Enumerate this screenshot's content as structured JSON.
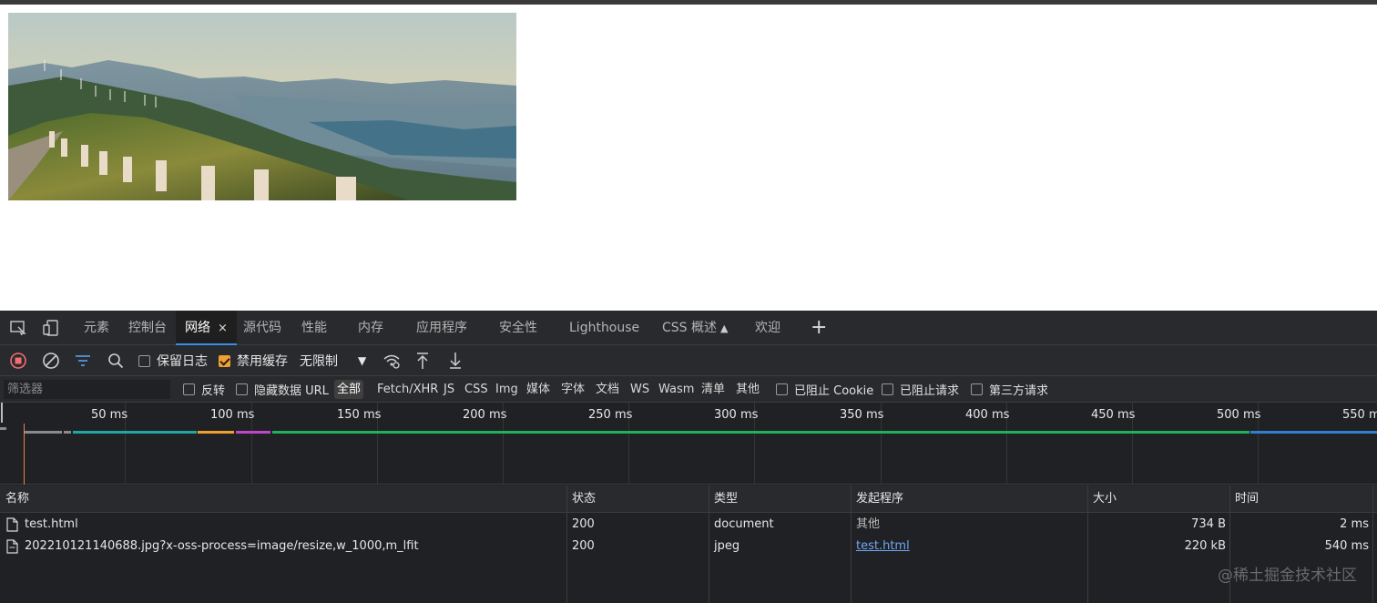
{
  "devtools": {
    "tabs": [
      {
        "label": "元素"
      },
      {
        "label": "控制台"
      },
      {
        "label": "网络",
        "active": true,
        "close": "×"
      },
      {
        "label": "源代码"
      },
      {
        "label": "性能"
      },
      {
        "label": "内存"
      },
      {
        "label": "应用程序"
      },
      {
        "label": "安全性"
      },
      {
        "label": "Lighthouse"
      },
      {
        "label": "CSS 概述"
      },
      {
        "label": "欢迎"
      }
    ],
    "add_tab": "+",
    "toolbar": {
      "preserve_log": {
        "label": "保留日志",
        "checked": false
      },
      "disable_cache": {
        "label": "禁用缓存",
        "checked": true
      },
      "throttling": "无限制",
      "throttling_arrow": "▼"
    },
    "filter": {
      "placeholder": "筛选器",
      "invert": {
        "label": "反转",
        "checked": false
      },
      "hide_data_urls": {
        "label": "隐藏数据 URL",
        "checked": false
      },
      "types": [
        "全部",
        "Fetch/XHR",
        "JS",
        "CSS",
        "Img",
        "媒体",
        "字体",
        "文档",
        "WS",
        "Wasm",
        "清单",
        "其他"
      ],
      "active_type": "全部",
      "blocked_cookies": {
        "label": "已阻止 Cookie",
        "checked": false
      },
      "blocked_requests": {
        "label": "已阻止请求",
        "checked": false
      },
      "third_party": {
        "label": "第三方请求",
        "checked": false
      }
    },
    "overview": {
      "ticks": [
        "50 ms",
        "100 ms",
        "150 ms",
        "200 ms",
        "250 ms",
        "300 ms",
        "350 ms",
        "400 ms",
        "450 ms",
        "500 ms",
        "550 ms"
      ],
      "colors": {
        "gray": "#8a8a8a",
        "teal": "#1fa7a0",
        "orange": "#f0a030",
        "purple": "#c046c8",
        "green": "#1eb25a",
        "blue": "#2f7fd4",
        "marker": "#e8834c"
      }
    },
    "table": {
      "headers": [
        "名称",
        "状态",
        "类型",
        "发起程序",
        "大小",
        "时间"
      ],
      "rows": [
        {
          "name": "test.html",
          "status": "200",
          "type": "document",
          "initiator": "其他",
          "initiator_link": false,
          "size": "734 B",
          "time": "2 ms"
        },
        {
          "name": "202210121140688.jpg?x-oss-process=image/resize,w_1000,m_lfit",
          "status": "200",
          "type": "jpeg",
          "initiator": "test.html",
          "initiator_link": true,
          "size": "220 kB",
          "time": "540 ms"
        }
      ]
    }
  },
  "watermark": "@稀土掘金技术社区"
}
